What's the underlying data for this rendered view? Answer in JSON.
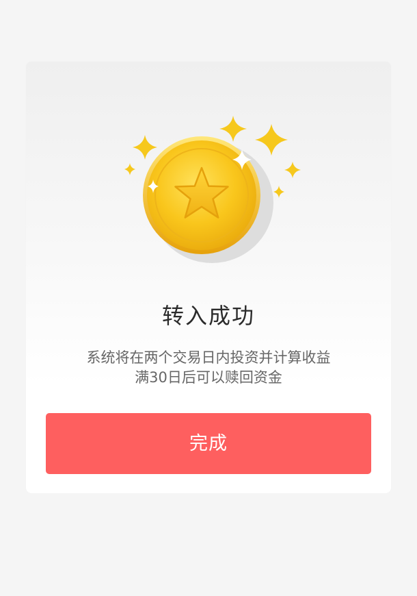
{
  "result": {
    "title": "转入成功",
    "description_line1": "系统将在两个交易日内投资并计算收益",
    "description_line2": "满30日后可以赎回资金"
  },
  "actions": {
    "done_label": "完成"
  },
  "icons": {
    "illustration": "gold-star-coin-icon",
    "decoration": "sparkle-icon"
  },
  "colors": {
    "accent": "#fe5f5f",
    "coin_gold": "#f7c21e",
    "background": "#f5f5f5"
  }
}
